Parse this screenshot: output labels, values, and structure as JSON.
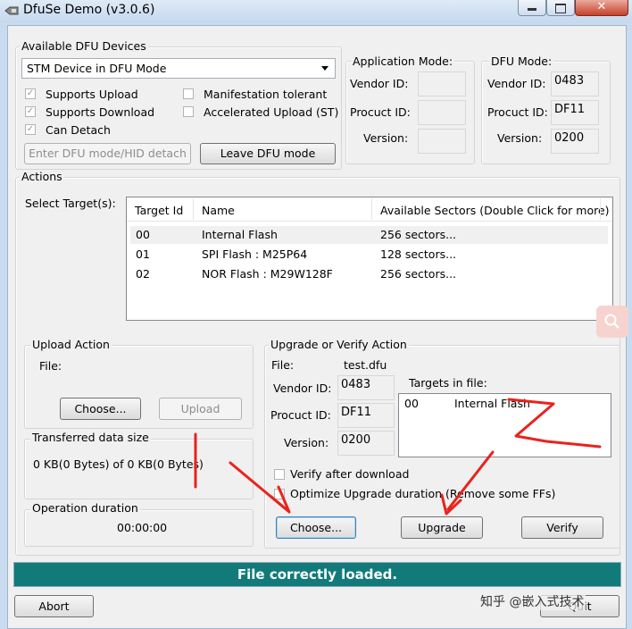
{
  "window": {
    "title": "DfuSe Demo (v3.0.6)",
    "close_glyph": "✕"
  },
  "devices": {
    "group_label": "Available DFU Devices",
    "selected_device": "STM Device in DFU Mode",
    "supports_upload": "Supports Upload",
    "supports_download": "Supports Download",
    "can_detach": "Can Detach",
    "manifestation_tolerant": "Manifestation tolerant",
    "accelerated_upload": "Accelerated Upload (ST)",
    "enter_dfu_button": "Enter DFU mode/HID detach",
    "leave_dfu_button": "Leave DFU mode"
  },
  "application_mode": {
    "label": "Application Mode:",
    "vendor_id_label": "Vendor ID:",
    "product_id_label": "Procuct ID:",
    "version_label": "Version:",
    "vendor_id": "",
    "product_id": "",
    "version": ""
  },
  "dfu_mode": {
    "label": "DFU Mode:",
    "vendor_id_label": "Vendor ID:",
    "product_id_label": "Procuct ID:",
    "version_label": "Version:",
    "vendor_id": "0483",
    "product_id": "DF11",
    "version": "0200"
  },
  "actions": {
    "group_label": "Actions",
    "select_target_label": "Select Target(s):",
    "columns": [
      "Target Id",
      "Name",
      "Available Sectors (Double Click for more)"
    ],
    "targets": [
      {
        "id": "00",
        "name": "Internal Flash",
        "sectors": "256 sectors..."
      },
      {
        "id": "01",
        "name": "SPI Flash : M25P64",
        "sectors": "128 sectors..."
      },
      {
        "id": "02",
        "name": "NOR Flash : M29W128F",
        "sectors": "256 sectors..."
      }
    ]
  },
  "upload": {
    "group_label": "Upload Action",
    "file_label": "File:",
    "choose_button": "Choose...",
    "upload_button": "Upload"
  },
  "transfer": {
    "group_label": "Transferred data size",
    "value": "0 KB(0 Bytes) of 0 KB(0 Bytes)"
  },
  "duration": {
    "group_label": "Operation duration",
    "value": "00:00:00"
  },
  "upgrade": {
    "group_label": "Upgrade or Verify Action",
    "file_label": "File:",
    "file_name": "test.dfu",
    "vendor_id_label": "Vendor ID:",
    "vendor_id": "0483",
    "product_id_label": "Procuct ID:",
    "product_id": "DF11",
    "version_label": "Version:",
    "version": "0200",
    "targets_in_file_label": "Targets in file:",
    "targets_in_file": [
      {
        "id": "00",
        "name": "Internal Flash"
      }
    ],
    "verify_after_download": "Verify after download",
    "optimize_upgrade": "Optimize Upgrade duration (Remove some FFs)",
    "choose_button": "Choose...",
    "upgrade_button": "Upgrade",
    "verify_button": "Verify"
  },
  "status": {
    "message": "File correctly loaded."
  },
  "footer": {
    "abort_button": "Abort",
    "quit_button": "Quit"
  },
  "watermark": {
    "text": "知乎 @嵌入式技术"
  },
  "icons": {
    "magnifier": "magnifier-icon",
    "app": "usb-plug-icon",
    "dropdown": "chevron-down-icon"
  },
  "colors": {
    "status_bar": "#137a7a",
    "annotation": "#e8231c",
    "title_bar": "#c5d8ee"
  }
}
